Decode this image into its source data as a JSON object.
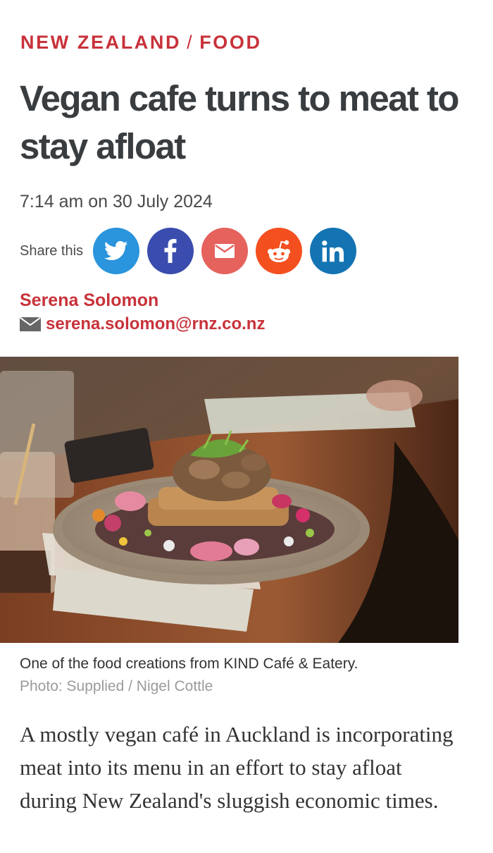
{
  "article": {
    "category_country": "NEW ZEALAND",
    "category_separator": "/",
    "category_section": "FOOD",
    "headline": "Vegan cafe turns to meat to stay afloat",
    "timestamp": "7:14 am on 30 July 2024",
    "share_label": "Share this",
    "share_buttons": [
      {
        "icon": "twitter-icon",
        "color": "#2a94dc"
      },
      {
        "icon": "facebook-icon",
        "color": "#3a4cad"
      },
      {
        "icon": "email-icon",
        "color": "#e5625d"
      },
      {
        "icon": "reddit-icon",
        "color": "#f4501f"
      },
      {
        "icon": "linkedin-icon",
        "color": "#1474b3"
      }
    ],
    "author_name": "Serena Solomon",
    "author_email": "serena.solomon@rnz.co.nz",
    "image": {
      "caption": "One of the food creations from KIND Café & Eatery.",
      "credit": "Photo: Supplied / Nigel Cottle"
    },
    "lead_paragraph": "A mostly vegan café in Auckland is incorporating meat into its menu in an effort to stay afloat during New Zealand's sluggish economic times."
  },
  "colors": {
    "accent_red": "#c8323a",
    "headline": "#3a3d40",
    "muted": "#9b9b9b"
  }
}
